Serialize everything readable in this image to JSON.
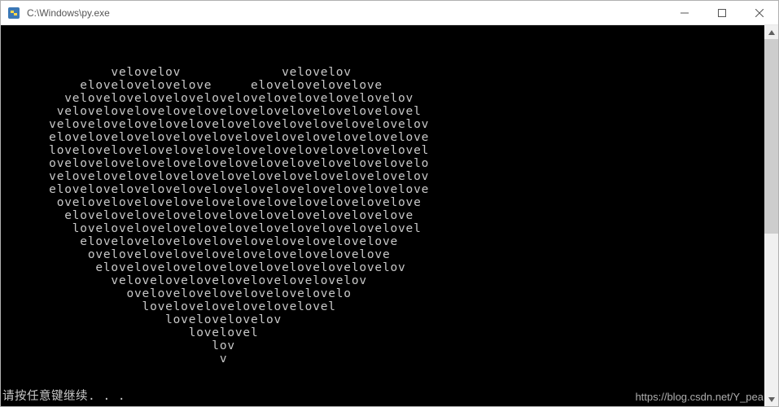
{
  "titlebar": {
    "path": "C:\\Windows\\py.exe",
    "buttons": {
      "minimize": "—",
      "maximize": "☐",
      "close": "✕"
    }
  },
  "console": {
    "lines": [
      "",
      "              velovelov             velovelov",
      "          elovelovelovelove     elovelovelovelove",
      "        velovelovelovelovelovelovelovelovelovelovelov",
      "       velovelovelovelovelovelovelovelovelovelovelovel",
      "      velovelovelovelovelovelovelovelovelovelovelovelov",
      "      elovelovelovelovelovelovelovelovelovelovelovelove",
      "      lovelovelovelovelovelovelovelovelovelovelovelovel",
      "      ovelovelovelovelovelovelovelovelovelovelovelovelo",
      "      velovelovelovelovelovelovelovelovelovelovelovelov",
      "      elovelovelovelovelovelovelovelovelovelovelovelove",
      "       ovelovelovelovelovelovelovelovelovelovelovelove",
      "        elovelovelovelovelovelovelovelovelovelovelove",
      "         lovelovelovelovelovelovelovelovelovelovelovel",
      "          elovelovelovelovelovelovelovelovelovelove",
      "           ovelovelovelovelovelovelovelovelovelove",
      "            elovelovelovelovelovelovelovelovelovelov",
      "              velovelovelovelovelovelovelovelov",
      "                ovelovelovelovelovelovelovelo",
      "                  lovelovelovelovelovelovel",
      "                     lovelovelovelov",
      "                        lovelovel",
      "                           lov",
      "                            v"
    ],
    "prompt": "请按任意键继续. . ."
  },
  "watermark": "https://blog.csdn.net/Y_pea",
  "colors": {
    "console_bg": "#000000",
    "console_fg": "#c8c8c8",
    "titlebar_bg": "#ffffff",
    "scrollbar_thumb": "#cdcdcd"
  }
}
